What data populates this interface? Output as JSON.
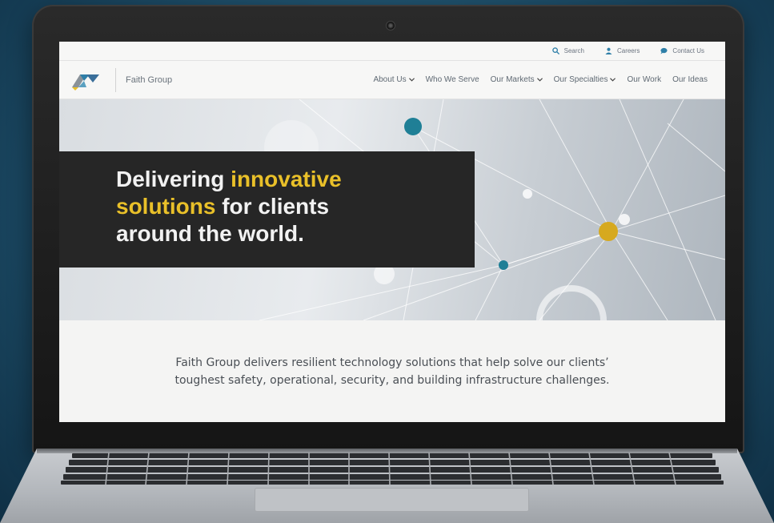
{
  "utility_bar": {
    "search_label": "Search",
    "careers_label": "Careers",
    "contact_label": "Contact Us"
  },
  "brand": {
    "name": "Faith Group"
  },
  "nav": {
    "about": "About Us",
    "who": "Who We Serve",
    "markets": "Our Markets",
    "specialties": "Our Specialties",
    "work": "Our Work",
    "ideas": "Our Ideas"
  },
  "hero": {
    "line1_a": "Delivering ",
    "line1_accent": "innovative",
    "line2_accent": "solutions",
    "line2_b": " for clients",
    "line3": "around the world."
  },
  "intro": {
    "text": "Faith Group delivers resilient technology solutions that help solve our clients’ toughest safety, operational, security, and building infrastructure challenges."
  },
  "colors": {
    "accent_yellow": "#e9c029",
    "node_teal": "#1f7f96",
    "headline_bg": "#262626"
  },
  "icons": [
    "search-icon",
    "person-icon",
    "chat-bubble-icon",
    "chevron-down-icon",
    "faith-group-logo"
  ]
}
